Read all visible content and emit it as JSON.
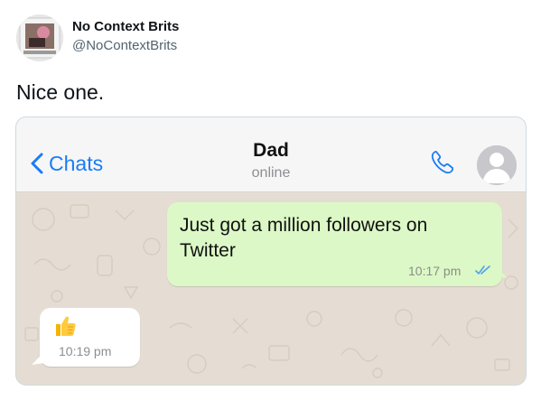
{
  "tweet": {
    "author_name": "No Context Brits",
    "author_handle": "@NoContextBrits",
    "text": "Nice one."
  },
  "chat_header": {
    "back_label": "Chats",
    "contact_name": "Dad",
    "contact_status": "online",
    "back_icon": "chevron-left-icon",
    "call_icon": "phone-icon",
    "avatar_icon": "person-placeholder-icon"
  },
  "messages": [
    {
      "direction": "outgoing",
      "text": "Just got a million followers on Twitter",
      "time": "10:17 pm",
      "status_icon": "double-check-read-icon"
    },
    {
      "direction": "incoming",
      "emoji": "thumbs-up",
      "time": "10:19 pm"
    }
  ],
  "colors": {
    "accent_blue": "#1a7cf5",
    "outgoing_bubble": "#dcf8c6",
    "incoming_bubble": "#ffffff",
    "chat_background": "#e5ddd3",
    "read_tick_blue": "#4fa3e8"
  }
}
